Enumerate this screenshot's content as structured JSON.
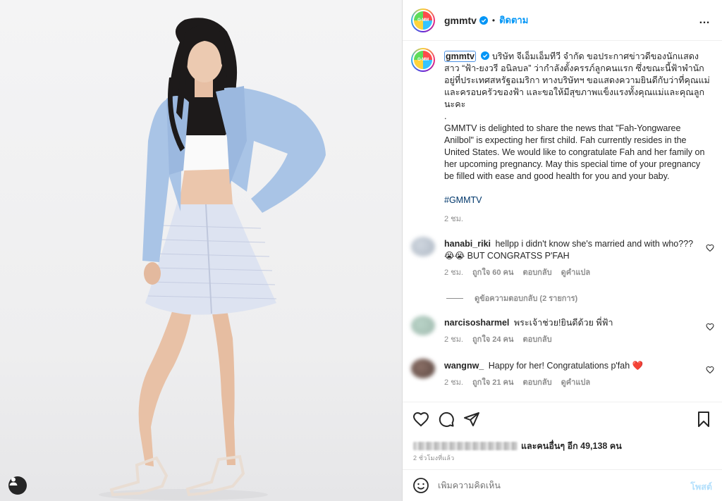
{
  "header": {
    "username": "gmmtv",
    "avatar_text": "G-MM",
    "separator": "•",
    "follow_label": "ติดตาม",
    "more_icon": "…"
  },
  "caption": {
    "username": "gmmtv",
    "thai_text": "บริษัท จีเอ็มเอ็มทีวี จำกัด ขอประกาศข่าวดีของนักแสดงสาว “ฟ้า-ยงวรี อนิลบล” ว่ากำลังตั้งครรภ์ลูกคนแรก ซึ่งขณะนี้ฟ้าพำนักอยู่ที่ประเทศสหรัฐอเมริกา ทางบริษัทฯ ขอแสดงความยินดีกับว่าที่คุณแม่และครอบครัวของฟ้า และขอให้มีสุขภาพแข็งแรงทั้งคุณแม่และคุณลูกนะคะ",
    "divider": ".",
    "english_text": "GMMTV is delighted to share the news that \"Fah-Yongwaree Anilbol\" is expecting her first child. Fah currently resides in the United States. We would like to congratulate Fah and her family on her upcoming pregnancy. May this special time of your pregnancy be filled with ease and good health for you and your baby.",
    "hashtag": "#GMMTV",
    "time": "2 ชม."
  },
  "comments": [
    {
      "username": "hanabi_riki",
      "text": "hellpp i didn't know she's married and with who??? 😭😭 BUT CONGRATSS P'FAH",
      "time": "2 ชม.",
      "likes": "ถูกใจ 60 คน",
      "reply": "ตอบกลับ",
      "translate": "ดูคำแปล",
      "view_replies": "ดูข้อความตอบกลับ (2 รายการ)"
    },
    {
      "username": "narcisosharmel",
      "text": "พระเจ้าช่วย!ยินดีด้วย พี่ฟ้า",
      "time": "2 ชม.",
      "likes": "ถูกใจ 24 คน",
      "reply": "ตอบกลับ"
    },
    {
      "username": "wangnw_",
      "text": "Happy for her! Congratulations p'fah ❤️",
      "time": "2 ชม.",
      "likes": "ถูกใจ 21 คน",
      "reply": "ตอบกลับ",
      "translate": "ดูคำแปล"
    }
  ],
  "actions": {
    "likes_text": "และคนอื่นๆ อีก 49,138 คน",
    "time_ago": "2 ชั่วโมงที่แล้ว"
  },
  "add_comment": {
    "placeholder": "เพิ่มความคิดเห็น",
    "post_label": "โพสต์"
  },
  "colors": {
    "accent": "#0095f6",
    "text": "#262626",
    "muted": "#8e8e8e",
    "hashtag": "#00376b",
    "heart_emoji": "#e0245e"
  },
  "icons": [
    "more-icon",
    "verified-icon",
    "heart-icon",
    "comment-icon",
    "share-icon",
    "bookmark-icon",
    "emoji-icon",
    "tagged-user-icon"
  ]
}
